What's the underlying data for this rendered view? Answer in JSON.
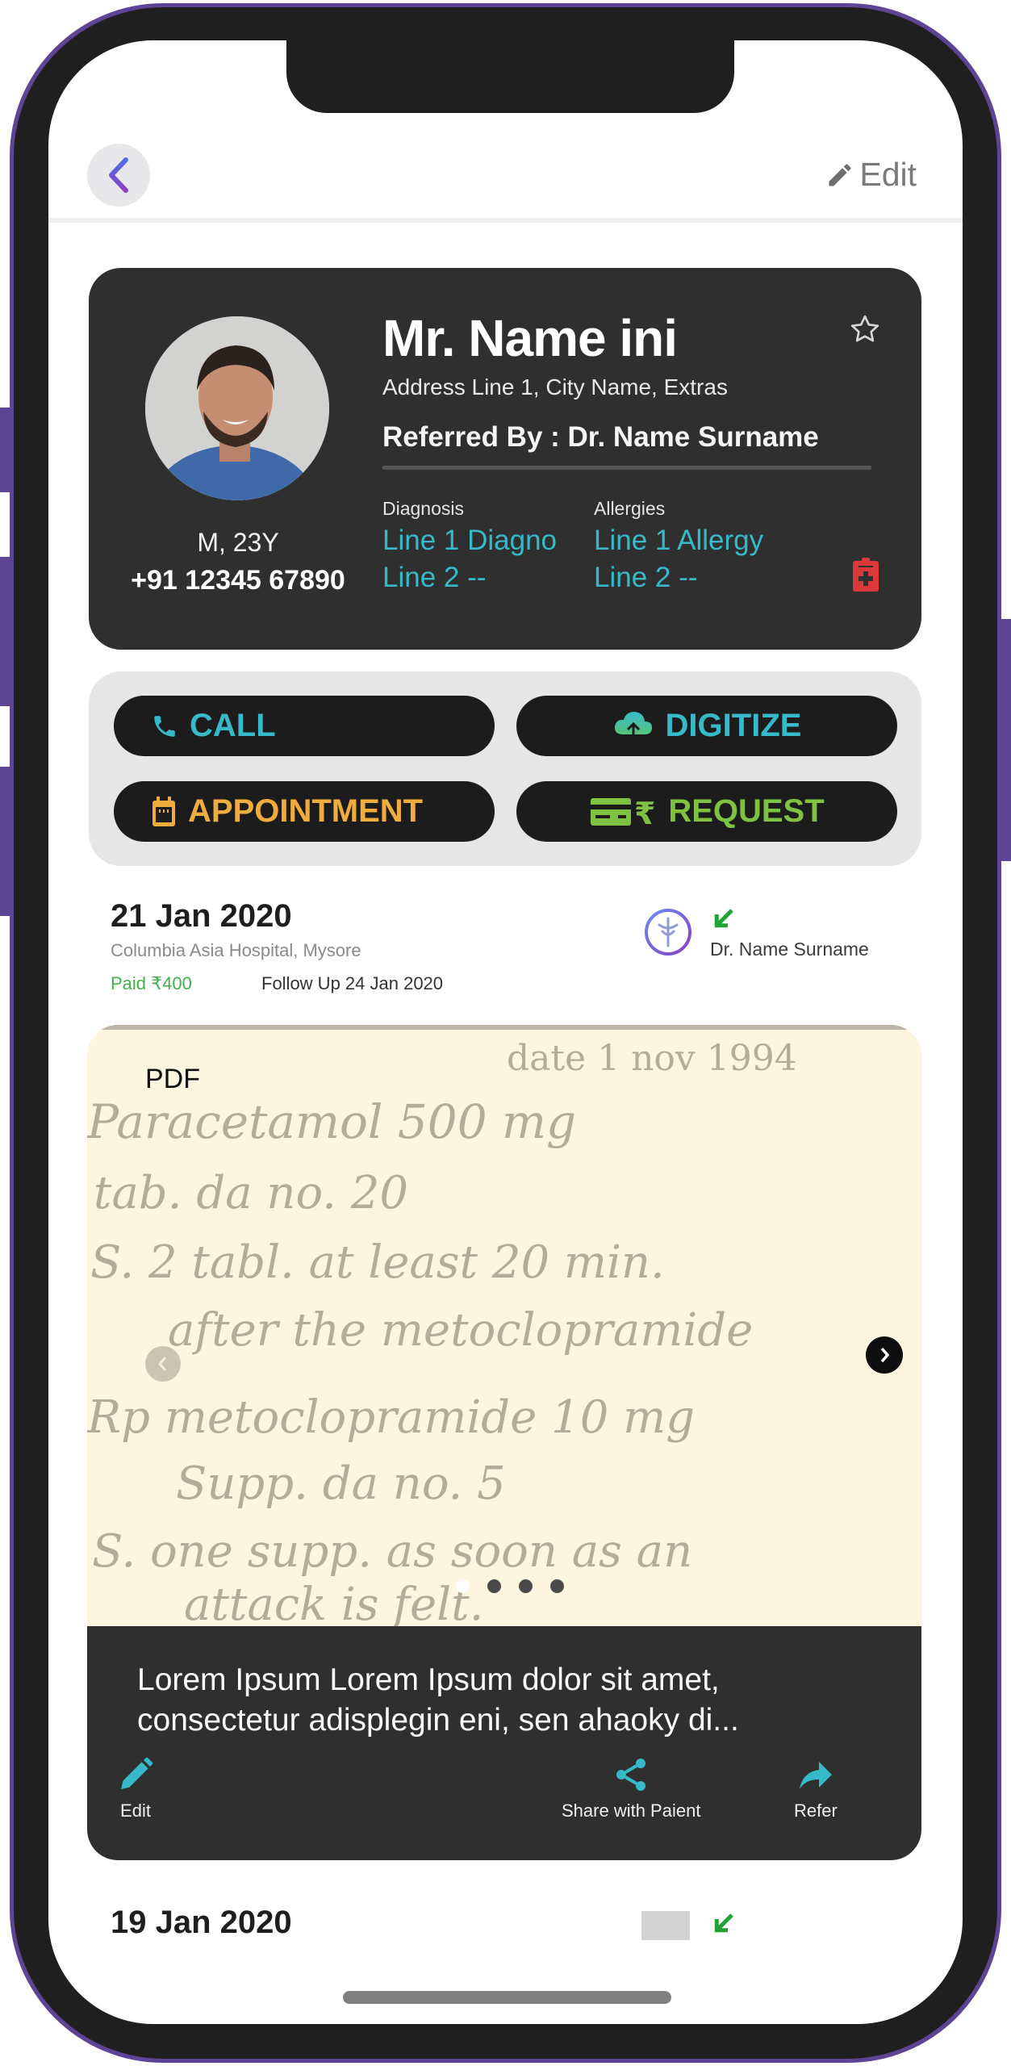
{
  "header": {
    "back_icon": "chevron-left-icon",
    "edit_label": "Edit",
    "edit_icon": "pencil-icon"
  },
  "patient": {
    "name": "Mr. Name ini",
    "address": "Address Line 1, City Name, Extras",
    "referred_by": "Referred By : Dr. Name Surname",
    "sex_age": "M, 23Y",
    "phone": "+91 12345 67890",
    "favorite_icon": "star-outline-icon",
    "diagnosis": {
      "label": "Diagnosis",
      "lines": [
        "Line 1 Diagno",
        "Line 2 --"
      ]
    },
    "allergies": {
      "label": "Allergies",
      "lines": [
        "Line 1 Allergy",
        "Line 2 --"
      ]
    },
    "medical_record_icon": "clipboard-medical-icon"
  },
  "actions": [
    {
      "label": "CALL",
      "icon": "phone-icon",
      "color": "#36b9c9"
    },
    {
      "label": "DIGITIZE",
      "icon": "cloud-upload-icon",
      "color": "#36b9c9"
    },
    {
      "label": "APPOINTMENT",
      "icon": "calendar-icon",
      "color": "#f0ac3c"
    },
    {
      "label": "REQUEST",
      "icon": "payment-rupee-icon",
      "color": "#7fc241"
    }
  ],
  "records": [
    {
      "date": "21 Jan 2020",
      "hospital": "Columbia Asia Hospital, Mysore",
      "paid": "Paid ₹400",
      "follow_up": "Follow Up 24 Jan 2020",
      "doctor": "Dr. Name Surname",
      "direction_icon": "arrow-down-left-icon",
      "attachment": {
        "type_label": "PDF",
        "handwriting": [
          "date  1 nov 1994",
          "Paracetamol  500 mg",
          "tab. da  no. 20",
          "S. 2 tabl. at  least 20 min.",
          "after the metoclopramide",
          "Rp  metoclopramide 10 mg",
          "Supp.  da  no. 5",
          "S.  one supp. as soon as an",
          "attack  is  felt."
        ],
        "carousel": {
          "total": 4,
          "active_index": 0
        }
      },
      "note": "Lorem Ipsum Lorem Ipsum dolor sit amet, consectetur adisplegin eni, sen ahaoky di...",
      "note_actions": [
        {
          "label": "Edit",
          "icon": "pencil-icon"
        },
        {
          "label": "Share with Paient",
          "icon": "share-icon"
        },
        {
          "label": "Refer",
          "icon": "forward-arrow-icon"
        }
      ]
    },
    {
      "date": "19 Jan 2020",
      "direction_icon": "arrow-down-left-icon"
    }
  ],
  "colors": {
    "frame": "#5e4495",
    "bezel": "#201f1f",
    "card_dark": "#2f2f2f",
    "accent_teal": "#36b9c9",
    "paid_green": "#43b04a",
    "alert_red": "#d9393a"
  }
}
